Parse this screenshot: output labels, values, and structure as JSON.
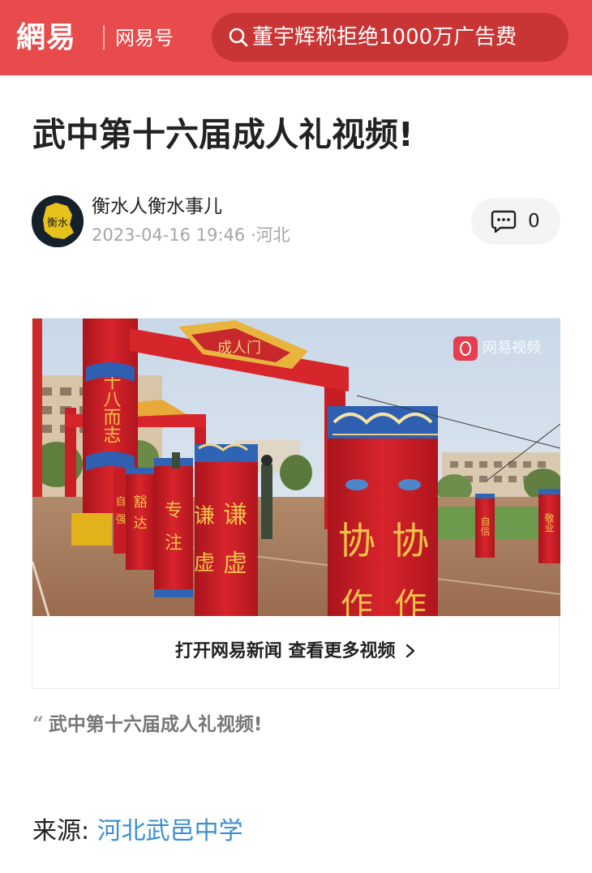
{
  "header": {
    "logo": "網易",
    "channel": "网易号",
    "search_query": "董宇辉称拒绝1000万广告费",
    "bg_color": "#e74b4b",
    "search_icon": "search-icon"
  },
  "article": {
    "title": "武中第十六届成人礼视频!",
    "author": {
      "name": "衡水人衡水事儿",
      "avatar_text": "衡水",
      "datetime": "2023-04-16 19:46",
      "location": "·河北"
    },
    "comments": {
      "icon": "comment-icon",
      "count": "0"
    },
    "video": {
      "watermark": "网易视频",
      "open_app_label": "打开网易新闻 查看更多视频",
      "open_app_icon": "chevron-right-icon",
      "scene_text": {
        "arch_sign": "成人门",
        "pillar_left_top": "十八而志",
        "pillar_humble_1": "谦",
        "pillar_humble_2": "虚",
        "pillar_xie_1": "协",
        "pillar_xie_2": "作",
        "pillar_focus_1": "专",
        "pillar_focus_2": "注",
        "pillar_ambition_1": "豁",
        "pillar_ambition_2": "达",
        "pillar_strong_1": "自",
        "pillar_strong_2": "强",
        "pillar_confidence": "自信",
        "pillar_dedication": "敬业"
      }
    },
    "quote": "武中第十六届成人礼视频!",
    "source_label": "来源:",
    "source_link": "河北武邑中学",
    "link_color": "#3b8fd1"
  }
}
